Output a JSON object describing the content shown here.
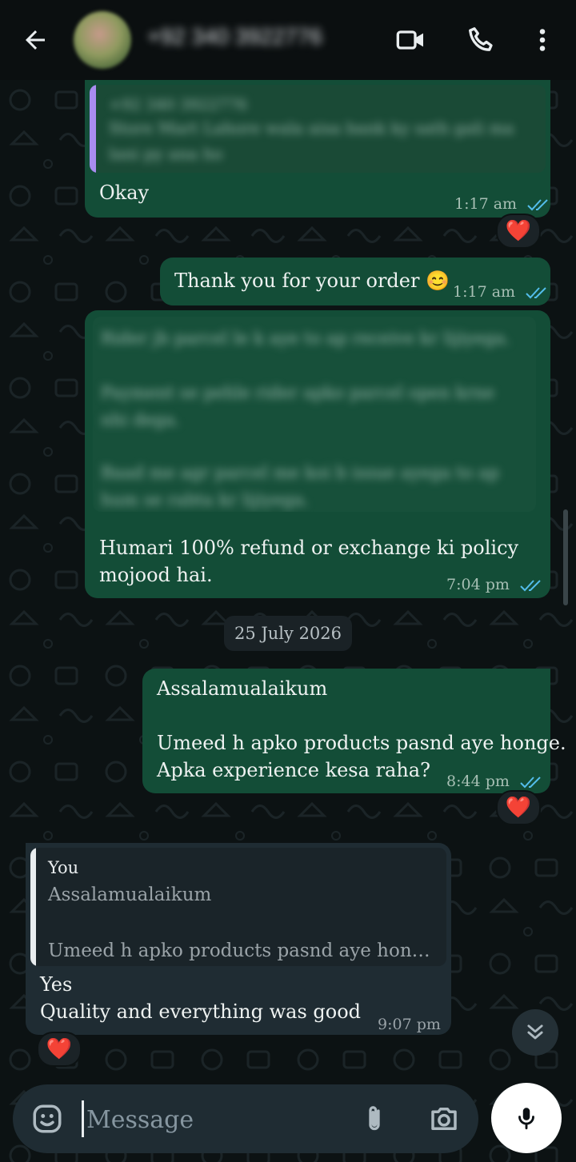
{
  "header": {
    "contact_name": "+92 340 3922776"
  },
  "messages": [
    {
      "quote_name": "+92 340 3922776",
      "quote_text": "Store Mart Lahore wala aisa bank ky sath gali ma lani py ana ho",
      "text": "Okay",
      "time": "1:17 am",
      "reaction": "❤️"
    },
    {
      "text": "Thank you for your order 😊",
      "time": "1:17 am"
    },
    {
      "blurred_lines": [
        "Rider jb parcel le k aye to ap receive kr lijiyega.",
        "Payment se pehle rider apko parcel open krne nhi dega.",
        "Baad me agr parcel me koi b issue ayega to ap hum se rabta kr lijiyega."
      ],
      "text_line1": "Humari 100% refund or exchange ki policy",
      "text_line2": "mojood hai.",
      "time": "7:04 pm"
    },
    {
      "line1": "Assalamualaikum",
      "line2": "Umeed h apko products pasnd aye honge.",
      "line3": "Apka experience kesa raha?",
      "time": "8:44 pm",
      "reaction": "❤️"
    },
    {
      "quote_name": "You",
      "quote_line1": "Assalamualaikum",
      "quote_line2": "Umeed h apko products pasnd aye hon…",
      "line1": "Yes",
      "line2": "Quality and everything was good",
      "time": "9:07 pm",
      "reaction": "❤️"
    }
  ],
  "date_separator": "25 July 2026",
  "composer": {
    "placeholder": "Message"
  },
  "colors": {
    "outgoing_bubble": "#134d37",
    "incoming_bubble": "#1f2c33",
    "read_ticks": "#53bdeb",
    "quote_bar": "#a98cf0"
  },
  "icons": [
    "back-arrow-icon",
    "video-call-icon",
    "phone-icon",
    "more-vert-icon",
    "emoji-icon",
    "attach-icon",
    "camera-icon",
    "mic-icon",
    "double-chevron-down-icon",
    "heart-icon"
  ]
}
